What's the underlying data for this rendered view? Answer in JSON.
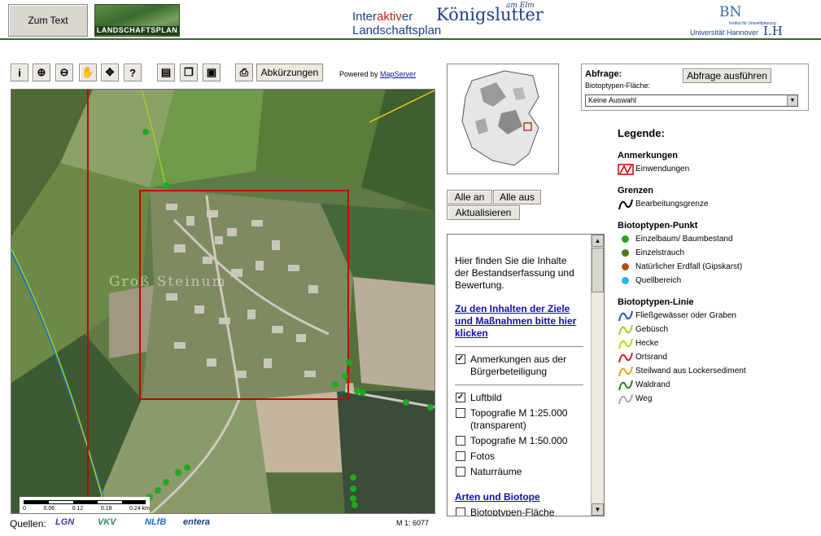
{
  "header": {
    "zum_text_label": "Zum Text",
    "landschaftsplan_logo_text": "LANDSCHAFTSPLAN",
    "title_line1_prefix": "Inter",
    "title_line1_accent": "aktiv",
    "title_line1_suffix": "er",
    "title_line2": "Landschaftsplan",
    "city_name": "Königslutter",
    "city_suffix": "am Elm",
    "uni_logo_letters": "BN",
    "uni_logo_small": "Institut für Umweltplanung",
    "uni_name": "Universität Hannover",
    "uni_logo_suffix": "I.H"
  },
  "toolbar": {
    "tools": [
      {
        "name": "info-tool",
        "glyph": "i"
      },
      {
        "name": "zoom-in-tool",
        "glyph": "⊕"
      },
      {
        "name": "zoom-out-tool",
        "glyph": "⊖"
      },
      {
        "name": "pan-tool",
        "glyph": "✋"
      },
      {
        "name": "full-extent-tool",
        "glyph": "✥"
      },
      {
        "name": "help-tool",
        "glyph": "?"
      },
      {
        "name": "print-tool",
        "glyph": "▤"
      },
      {
        "name": "copy-tool",
        "glyph": "❐"
      },
      {
        "name": "select-tool",
        "glyph": "▣"
      },
      {
        "name": "printer-tool",
        "glyph": "⎙"
      }
    ],
    "abkuerzungen_label": "Abkürzungen",
    "powered_by": "Powered by",
    "mapserver_link": "MapServer"
  },
  "map": {
    "town_label": "Groß Steinum",
    "scale_ticks": [
      "0",
      "0.06",
      "0.12",
      "0.18",
      "0.24 km"
    ],
    "scale_ratio": "M 1: 6077",
    "sources_label": "Quellen:",
    "source_logos": [
      "LGN",
      "VKV",
      "NLfB",
      "entera"
    ]
  },
  "overview_buttons": {
    "alle_an": "Alle an",
    "alle_aus": "Alle aus",
    "aktualisieren": "Aktualisieren"
  },
  "layer_panel": {
    "intro": "Hier finden Sie die Inhalte der Bestandserfassung und Bewertung.",
    "link_ziele": "Zu den Inhalten der Ziele und Maßnahmen bitte hier klicken",
    "layers": [
      {
        "label": "Anmerkungen aus der Bürgerbeteiligung",
        "checked": true
      },
      {
        "label": "Luftbild",
        "checked": true
      },
      {
        "label": "Topografie M 1:25.000 (transparent)",
        "checked": false
      },
      {
        "label": "Topografie M 1:50.000",
        "checked": false
      },
      {
        "label": "Fotos",
        "checked": false
      },
      {
        "label": "Naturräume",
        "checked": false
      }
    ],
    "section_arten": "Arten und Biotope",
    "section_layers": [
      {
        "label": "Biotoptypen-Fläche",
        "checked": false
      }
    ]
  },
  "query": {
    "title": "Abfrage:",
    "subtitle": "Biotoptypen-Fläche:",
    "button_label": "Abfrage ausführen",
    "selected_value": "Keine Auswahl"
  },
  "legend": {
    "title": "Legende:",
    "sections": [
      {
        "title": "Anmerkungen",
        "items": [
          {
            "label": "Einwendungen",
            "symbol": "box",
            "color": "#cc0000"
          }
        ]
      },
      {
        "title": "Grenzen",
        "items": [
          {
            "label": "Bearbeitungsgrenze",
            "symbol": "line",
            "color": "#000000"
          }
        ]
      },
      {
        "title": "Biotoptypen-Punkt",
        "items": [
          {
            "label": "Einzelbaum/ Baumbestand",
            "symbol": "dot",
            "color": "#22a822"
          },
          {
            "label": "Einzelstrauch",
            "symbol": "dot",
            "color": "#4f7a1f"
          },
          {
            "label": "Natürlicher Erdfall (Gipskarst)",
            "symbol": "dot",
            "color": "#b0501e"
          },
          {
            "label": "Quellbereich",
            "symbol": "dot",
            "color": "#1fb8e8"
          }
        ]
      },
      {
        "title": "Biotoptypen-Linie",
        "items": [
          {
            "label": "Fließgewässer oder Graben",
            "symbol": "line",
            "color": "#1f4fc8"
          },
          {
            "label": "Gebüsch",
            "symbol": "line",
            "color": "#9ad21f"
          },
          {
            "label": "Hecke",
            "symbol": "line",
            "color": "#b8d41f"
          },
          {
            "label": "Ortsrand",
            "symbol": "line",
            "color": "#d21f1f"
          },
          {
            "label": "Steilwand aus Lockersediment",
            "symbol": "line",
            "color": "#d8a81f"
          },
          {
            "label": "Waldrand",
            "symbol": "line",
            "color": "#2f7a1f"
          },
          {
            "label": "Weg",
            "symbol": "line",
            "color": "#a8a8a8"
          }
        ]
      }
    ]
  }
}
